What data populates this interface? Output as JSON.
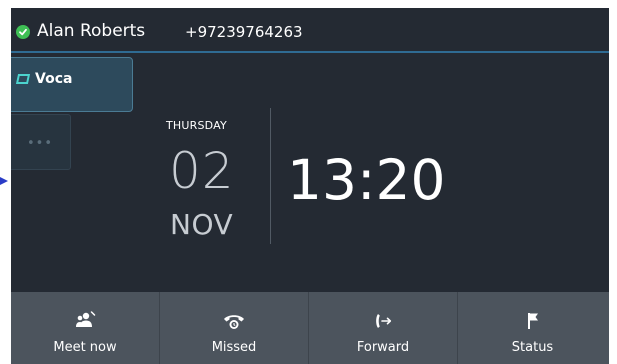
{
  "status": {
    "presence_icon": "check-circle-icon",
    "presence_color": "#3fbf55",
    "user_name": "Alan Roberts",
    "user_number": "+97239764263"
  },
  "line_keys": [
    {
      "label": "Voca",
      "icon": "line-key-icon"
    }
  ],
  "more_key": {
    "label": "•••"
  },
  "clock": {
    "weekday": "THURSDAY",
    "day": "02",
    "month": "NOV",
    "time": "13:20"
  },
  "softkeys": [
    {
      "label": "Meet now",
      "icon": "people-add-icon"
    },
    {
      "label": "Missed",
      "icon": "phone-missed-icon"
    },
    {
      "label": "Forward",
      "icon": "call-forward-icon"
    },
    {
      "label": "Status",
      "icon": "flag-icon"
    }
  ],
  "colors": {
    "background": "#242a33",
    "accent": "#2f6b93",
    "softkey_bar": "#4c545d",
    "line_key": "#2d4a5c"
  }
}
